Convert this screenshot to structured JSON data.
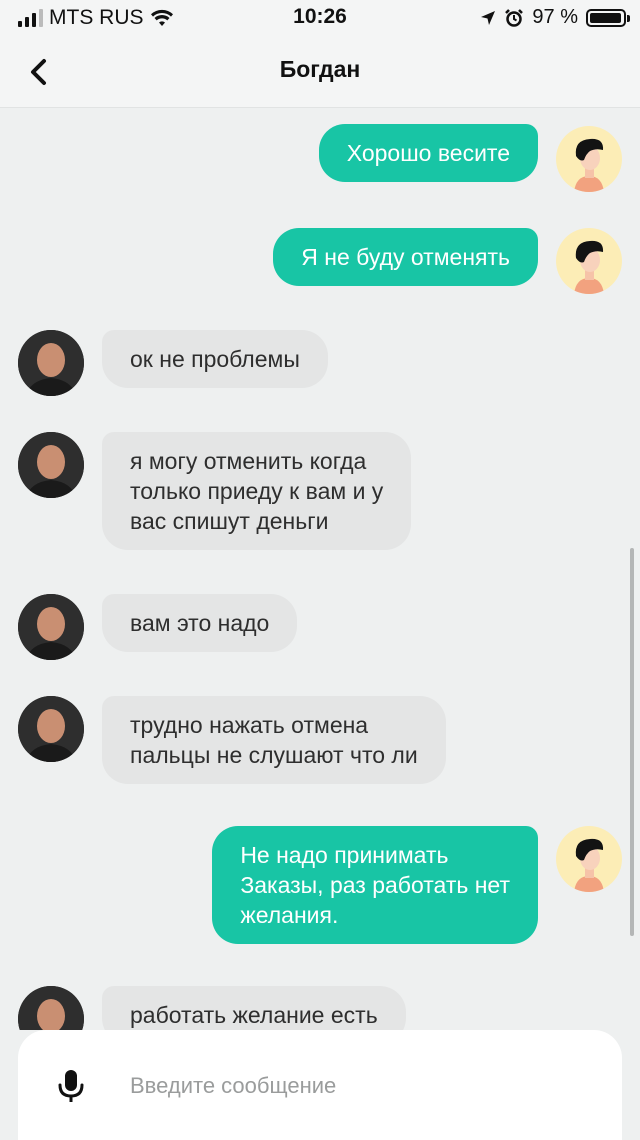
{
  "status_bar": {
    "carrier": "MTS RUS",
    "time": "10:26",
    "battery_text": "97 %",
    "battery_level": 0.97,
    "signal_bars": 3
  },
  "header": {
    "title": "Богдан"
  },
  "messages": [
    {
      "from": "me",
      "text": "Хорошо весите"
    },
    {
      "from": "me",
      "text": "Я не буду отменять"
    },
    {
      "from": "contact",
      "text": "ок не проблемы"
    },
    {
      "from": "contact",
      "text": "я могу отменить когда\nтолько приеду к вам и у\nвас спишут деньги"
    },
    {
      "from": "contact",
      "text": "вам это надо"
    },
    {
      "from": "contact",
      "text": "трудно нажать отмена\nпальцы не слушают что ли"
    },
    {
      "from": "me",
      "text": "Не надо принимать\nЗаказы, раз работать нет\nжелания."
    },
    {
      "from": "contact",
      "text": "работать желание есть"
    }
  ],
  "composer": {
    "placeholder": "Введите сообщение"
  },
  "colors": {
    "outgoing": "#18c5a5",
    "incoming": "#e4e5e5",
    "background": "#eef0f0"
  }
}
